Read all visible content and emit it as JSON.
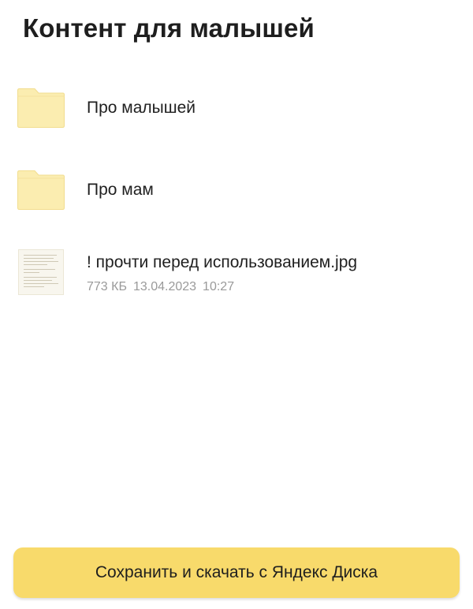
{
  "page": {
    "title": "Контент для малышей"
  },
  "items": [
    {
      "type": "folder",
      "icon": "folder-icon",
      "name": "Про малышей"
    },
    {
      "type": "folder",
      "icon": "folder-icon",
      "name": "Про мам"
    },
    {
      "type": "file",
      "icon": "image-thumbnail",
      "name": "! прочти перед использованием.jpg",
      "size": "773 КБ",
      "date": "13.04.2023",
      "time": "10:27"
    }
  ],
  "actions": {
    "save_label": "Сохранить и скачать с Яндекс Диска"
  },
  "colors": {
    "folder": "#fbedb0",
    "folder_border": "#f2dd8f",
    "button": "#f8da6b",
    "meta_text": "#9a9a9a"
  }
}
